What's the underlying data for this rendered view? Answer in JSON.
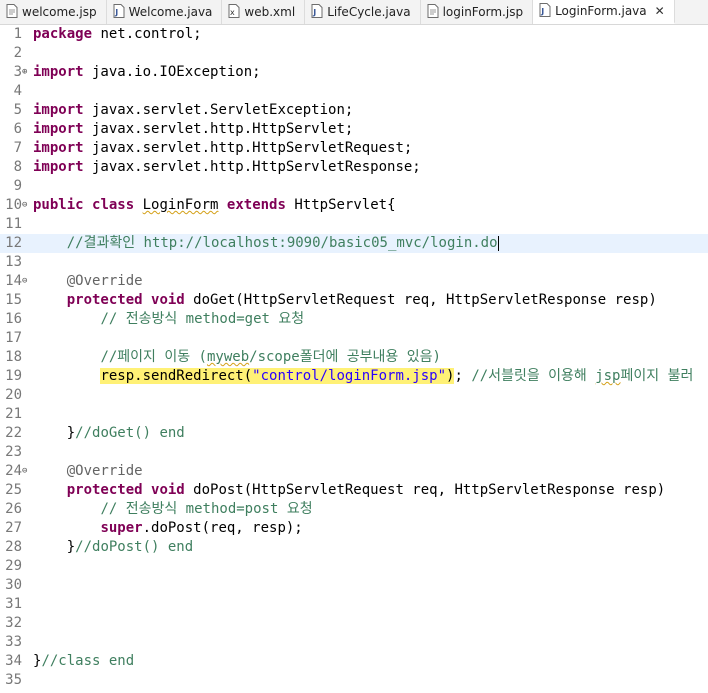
{
  "tabs": [
    {
      "label": "welcome.jsp",
      "icon": "jsp-file-icon",
      "active": false
    },
    {
      "label": "Welcome.java",
      "icon": "java-file-icon",
      "active": false
    },
    {
      "label": "web.xml",
      "icon": "xml-file-icon",
      "active": false
    },
    {
      "label": "LifeCycle.java",
      "icon": "java-file-icon",
      "active": false
    },
    {
      "label": "loginForm.jsp",
      "icon": "jsp-file-icon",
      "active": false
    },
    {
      "label": "LoginForm.java",
      "icon": "java-file-icon",
      "active": true,
      "close_label": "✕"
    }
  ],
  "lines": [
    {
      "n": "1",
      "fold": "",
      "tokens": [
        {
          "t": "package",
          "c": "kw"
        },
        {
          "t": " net.control;"
        }
      ]
    },
    {
      "n": "2",
      "fold": "",
      "tokens": []
    },
    {
      "n": "3",
      "fold": "⊕",
      "tokens": [
        {
          "t": "import",
          "c": "kw"
        },
        {
          "t": " java.io.IOException;"
        }
      ]
    },
    {
      "n": "4",
      "fold": "",
      "tokens": []
    },
    {
      "n": "5",
      "fold": "",
      "tokens": [
        {
          "t": "import",
          "c": "kw"
        },
        {
          "t": " javax.servlet.ServletException;"
        }
      ]
    },
    {
      "n": "6",
      "fold": "",
      "tokens": [
        {
          "t": "import",
          "c": "kw"
        },
        {
          "t": " javax.servlet.http.HttpServlet;"
        }
      ]
    },
    {
      "n": "7",
      "fold": "",
      "tokens": [
        {
          "t": "import",
          "c": "kw"
        },
        {
          "t": " javax.servlet.http.HttpServletRequest;"
        }
      ]
    },
    {
      "n": "8",
      "fold": "",
      "tokens": [
        {
          "t": "import",
          "c": "kw"
        },
        {
          "t": " javax.servlet.http.HttpServletResponse;"
        }
      ]
    },
    {
      "n": "9",
      "fold": "",
      "tokens": []
    },
    {
      "n": "10",
      "fold": "⊖",
      "tokens": [
        {
          "t": "public",
          "c": "kw"
        },
        {
          "t": " "
        },
        {
          "t": "class",
          "c": "kw"
        },
        {
          "t": " "
        },
        {
          "t": "LoginForm",
          "c": "squig"
        },
        {
          "t": " "
        },
        {
          "t": "extends",
          "c": "kw"
        },
        {
          "t": " HttpServlet{"
        }
      ]
    },
    {
      "n": "11",
      "fold": "",
      "tokens": []
    },
    {
      "n": "12",
      "fold": "",
      "current": true,
      "caret": true,
      "tokens": [
        {
          "t": "    "
        },
        {
          "t": "//결과확인 http://localhost:9090/basic05_mvc/login.do",
          "c": "cm"
        }
      ]
    },
    {
      "n": "13",
      "fold": "",
      "tokens": []
    },
    {
      "n": "14",
      "fold": "⊖",
      "tokens": [
        {
          "t": "    "
        },
        {
          "t": "@Override",
          "c": "an"
        }
      ]
    },
    {
      "n": "15",
      "fold": "",
      "tokens": [
        {
          "t": "    "
        },
        {
          "t": "protected",
          "c": "kw"
        },
        {
          "t": " "
        },
        {
          "t": "void",
          "c": "kw"
        },
        {
          "t": " doGet(HttpServletRequest req, HttpServletResponse resp)"
        }
      ]
    },
    {
      "n": "16",
      "fold": "",
      "tokens": [
        {
          "t": "        "
        },
        {
          "t": "// 전송방식 method=get 요청",
          "c": "cm"
        }
      ]
    },
    {
      "n": "17",
      "fold": "",
      "tokens": []
    },
    {
      "n": "18",
      "fold": "",
      "tokens": [
        {
          "t": "        "
        },
        {
          "t": "//페이지 이동 (",
          "c": "cm"
        },
        {
          "t": "myweb",
          "c": "cm squig"
        },
        {
          "t": "/scope폴더에 공부내용 있음)",
          "c": "cm"
        }
      ]
    },
    {
      "n": "19",
      "fold": "",
      "tokens": [
        {
          "t": "        "
        },
        {
          "t": "resp.sendRedirect(",
          "c": "hl"
        },
        {
          "t": "\"control/loginForm.jsp\"",
          "c": "st hl"
        },
        {
          "t": ")",
          "c": "hl"
        },
        {
          "t": "; "
        },
        {
          "t": "//서블릿을 이용해 ",
          "c": "cm"
        },
        {
          "t": "jsp",
          "c": "cm squig"
        },
        {
          "t": "페이지 불러",
          "c": "cm"
        }
      ]
    },
    {
      "n": "20",
      "fold": "",
      "tokens": []
    },
    {
      "n": "21",
      "fold": "",
      "tokens": []
    },
    {
      "n": "22",
      "fold": "",
      "tokens": [
        {
          "t": "    }"
        },
        {
          "t": "//doGet() end",
          "c": "cm"
        }
      ]
    },
    {
      "n": "23",
      "fold": "",
      "tokens": []
    },
    {
      "n": "24",
      "fold": "⊖",
      "tokens": [
        {
          "t": "    "
        },
        {
          "t": "@Override",
          "c": "an"
        }
      ]
    },
    {
      "n": "25",
      "fold": "",
      "tokens": [
        {
          "t": "    "
        },
        {
          "t": "protected",
          "c": "kw"
        },
        {
          "t": " "
        },
        {
          "t": "void",
          "c": "kw"
        },
        {
          "t": " doPost(HttpServletRequest req, HttpServletResponse resp)"
        }
      ]
    },
    {
      "n": "26",
      "fold": "",
      "tokens": [
        {
          "t": "        "
        },
        {
          "t": "// 전송방식 method=post 요청",
          "c": "cm"
        }
      ]
    },
    {
      "n": "27",
      "fold": "",
      "tokens": [
        {
          "t": "        "
        },
        {
          "t": "super",
          "c": "kw"
        },
        {
          "t": ".doPost(req, resp);"
        }
      ]
    },
    {
      "n": "28",
      "fold": "",
      "tokens": [
        {
          "t": "    }"
        },
        {
          "t": "//doPost() end",
          "c": "cm"
        }
      ]
    },
    {
      "n": "29",
      "fold": "",
      "tokens": []
    },
    {
      "n": "30",
      "fold": "",
      "tokens": []
    },
    {
      "n": "31",
      "fold": "",
      "tokens": []
    },
    {
      "n": "32",
      "fold": "",
      "tokens": []
    },
    {
      "n": "33",
      "fold": "",
      "tokens": []
    },
    {
      "n": "34",
      "fold": "",
      "tokens": [
        {
          "t": "}"
        },
        {
          "t": "//class end",
          "c": "cm"
        }
      ]
    },
    {
      "n": "35",
      "fold": "",
      "tokens": []
    }
  ]
}
